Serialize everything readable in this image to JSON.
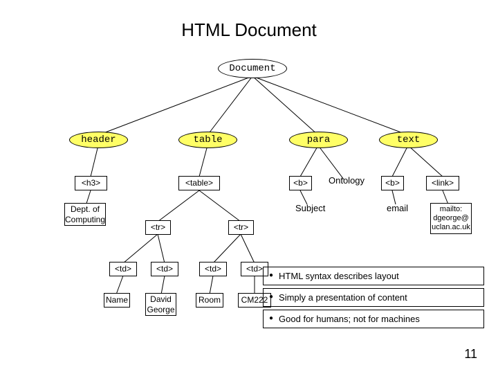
{
  "title": "HTML Document",
  "nodes": {
    "document": "Document",
    "header": "header",
    "table": "table",
    "para": "para",
    "text": "text",
    "h3": "<h3>",
    "table_tag": "<table>",
    "b1": "<b>",
    "b2": "<b>",
    "link_tag": "<link>",
    "dept_line1": "Dept. of",
    "dept_line2": "Computing",
    "tr1": "<tr>",
    "tr2": "<tr>",
    "td1": "<td>",
    "td2": "<td>",
    "td3": "<td>",
    "td4": "<td>",
    "name": "Name",
    "david_line1": "David",
    "david_line2": "George",
    "room": "Room",
    "cm222": "CM222",
    "ontology": "Ontology",
    "subject": "Subject",
    "email": "email",
    "mailto_line1": "mailto:",
    "mailto_line2": "dgeorge@",
    "mailto_line3": "uclan.ac.uk"
  },
  "bullets": [
    "HTML syntax describes layout",
    "Simply a presentation of content",
    "Good for humans; not for machines"
  ],
  "page": "11"
}
